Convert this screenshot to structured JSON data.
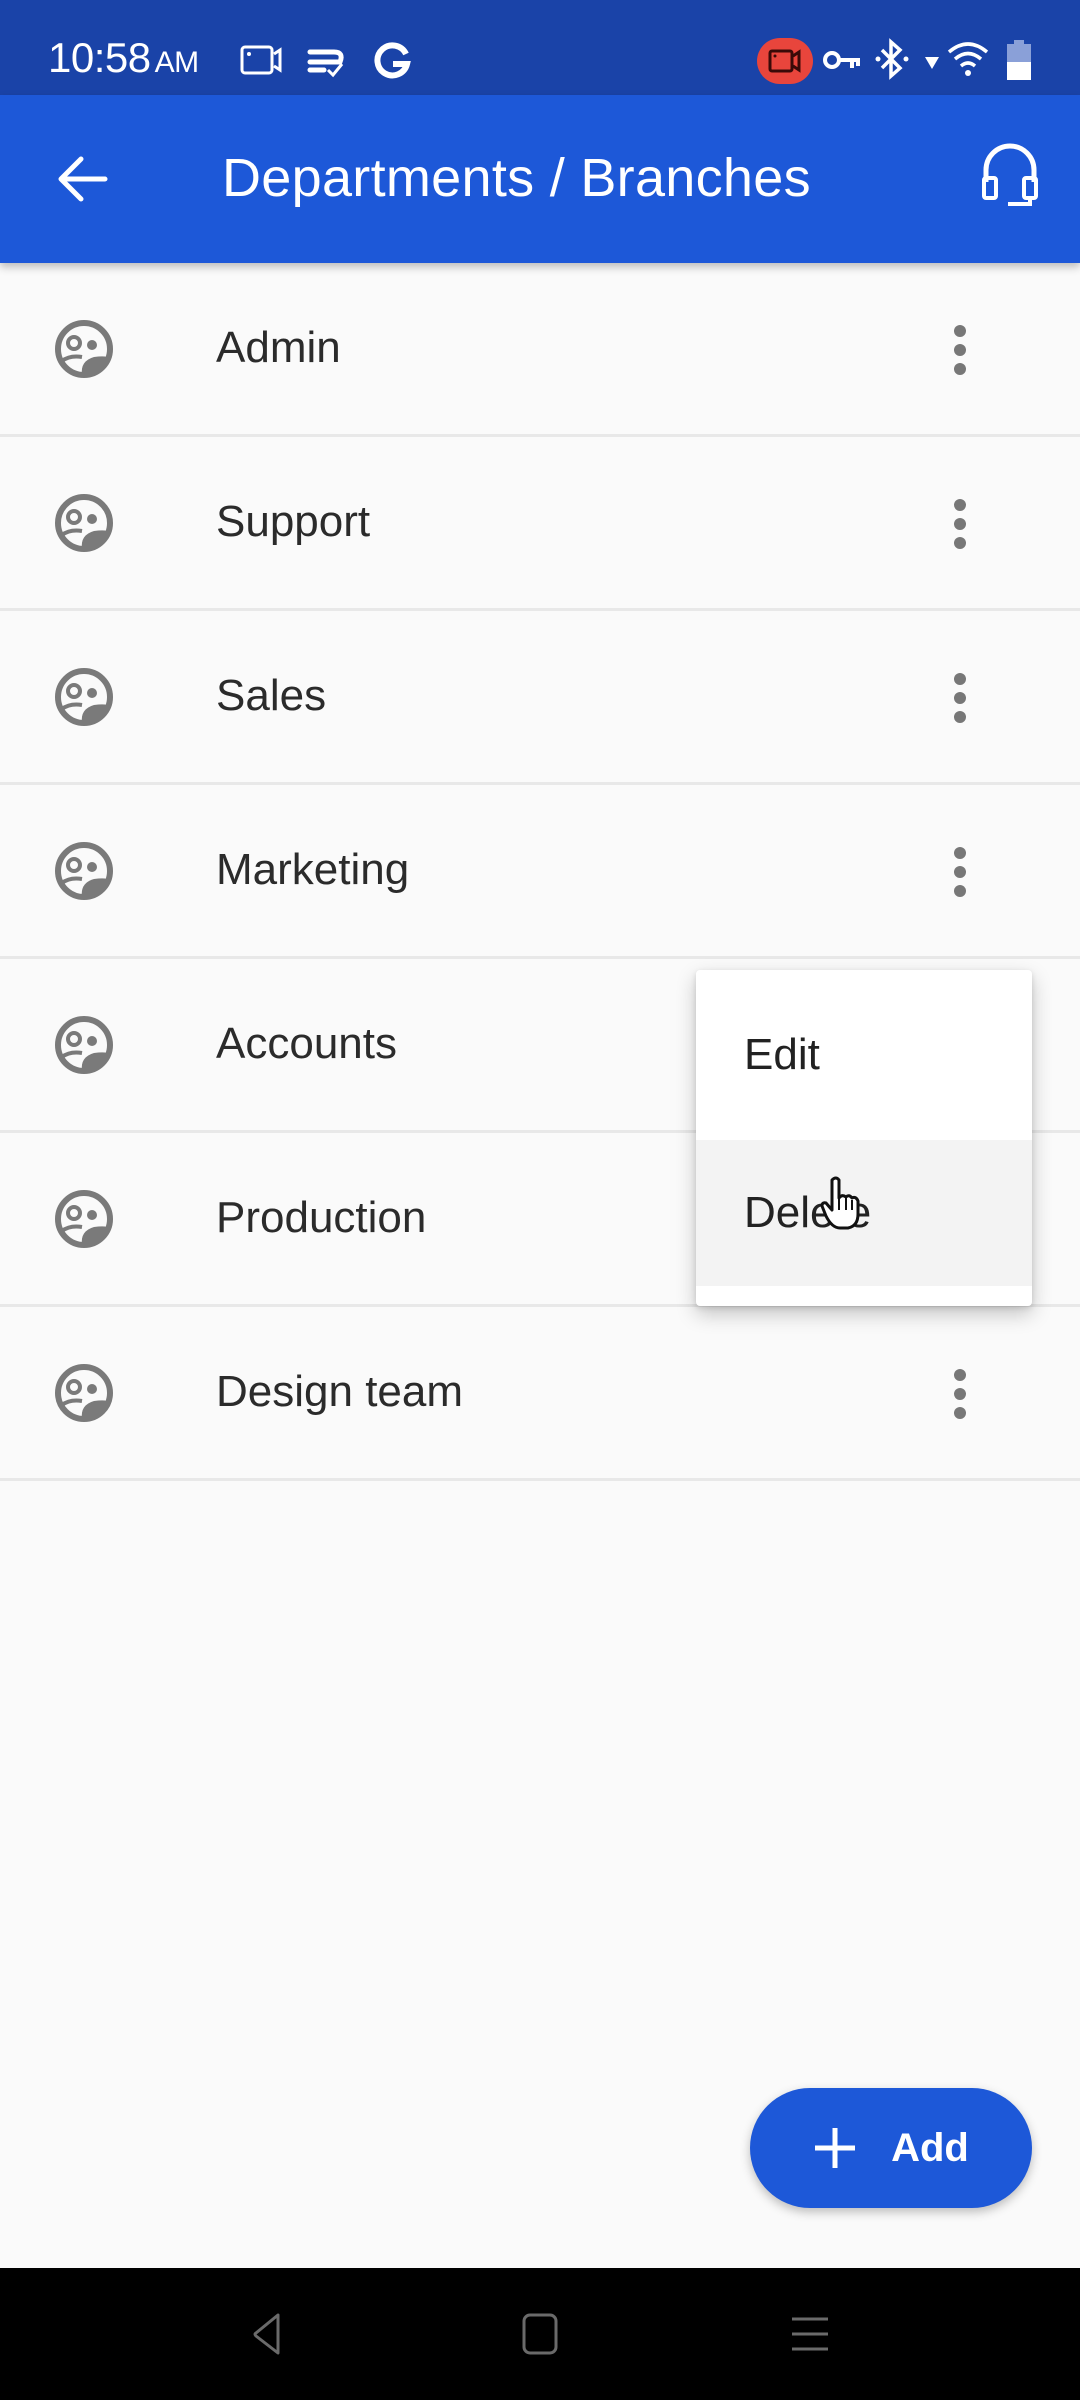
{
  "status_bar": {
    "time": "10:58",
    "ampm": "AM",
    "left_icons": [
      "screen-record-icon",
      "sync-check-icon",
      "google-icon"
    ],
    "right_icons": [
      "recording-indicator-icon",
      "vpn-key-icon",
      "bluetooth-icon",
      "data-arrow-icon",
      "wifi-icon",
      "battery-icon"
    ]
  },
  "app_bar": {
    "title": "Departments / Branches",
    "back_icon": "arrow-left-icon",
    "support_icon": "headset-icon"
  },
  "departments": [
    {
      "name": "Admin"
    },
    {
      "name": "Support"
    },
    {
      "name": "Sales"
    },
    {
      "name": "Marketing"
    },
    {
      "name": "Accounts"
    },
    {
      "name": "Production"
    },
    {
      "name": "Design team"
    }
  ],
  "context_menu": {
    "target": "Accounts",
    "items": [
      {
        "label": "Edit"
      },
      {
        "label": "Delete",
        "highlighted": true
      }
    ]
  },
  "fab": {
    "label": "Add",
    "icon": "plus-icon"
  },
  "nav_bar": {
    "buttons": [
      "back-triangle-icon",
      "home-square-icon",
      "menu-lines-icon"
    ]
  },
  "colors": {
    "status_bar": "#1a43a8",
    "app_bar": "#1d58d8",
    "fab": "#1d58d8",
    "recording_pill": "#e8453c",
    "icon_gray": "#777777",
    "background": "#fafafa",
    "menu_highlight": "#f3f3f3"
  }
}
